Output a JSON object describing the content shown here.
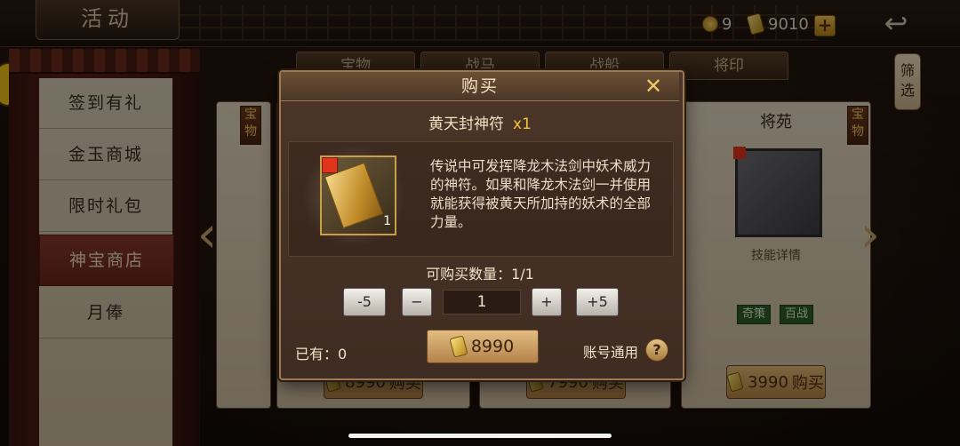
{
  "header": {
    "title": "活动",
    "coins": "9",
    "gold": "9010",
    "plus_label": "+",
    "back_label": "↩"
  },
  "sidebar": {
    "items": [
      {
        "label": "签到有礼"
      },
      {
        "label": "金玉商城"
      },
      {
        "label": "限时礼包"
      },
      {
        "label": "神宝商店"
      },
      {
        "label": "月俸"
      }
    ],
    "active_index": 3
  },
  "tabs": [
    {
      "label": "宝物"
    },
    {
      "label": "战马"
    },
    {
      "label": "战船"
    },
    {
      "label": "将印"
    }
  ],
  "filter_label": "筛选",
  "cards": [
    {
      "tag": "宝物",
      "price": "",
      "buy_label": "购买"
    },
    {
      "tag": "",
      "price": "8990",
      "buy_label": "购买"
    },
    {
      "tag": "",
      "price": "7990",
      "buy_label": "购买"
    },
    {
      "tag": "宝物",
      "title": "将苑",
      "detail": "技能详情",
      "chips": [
        "奇策",
        "百战"
      ],
      "price": "3990",
      "buy_label": "购买"
    }
  ],
  "arrows": {
    "left": "‹",
    "right": "›"
  },
  "modal": {
    "title": "购买",
    "close": "✕",
    "item_name": "黄天封神符",
    "item_qty": "x1",
    "item_count": "1",
    "description": "传说中可发挥降龙木法剑中妖术威力的神符。如果和降龙木法剑一并使用就能获得被黄天所加持的妖术的全部力量。",
    "purchasable_label": "可购买数量：1/1",
    "buttons": {
      "minus5": "-5",
      "minus": "−",
      "plus": "+",
      "plus5": "+5"
    },
    "quantity": "1",
    "owned_label": "已有：0",
    "price": "8990",
    "account_label": "账号通用",
    "help": "?"
  },
  "colors": {
    "accent_gold": "#f0c43a",
    "active_menu": "#7a2e24",
    "chip_green": "#2f5e2f"
  }
}
